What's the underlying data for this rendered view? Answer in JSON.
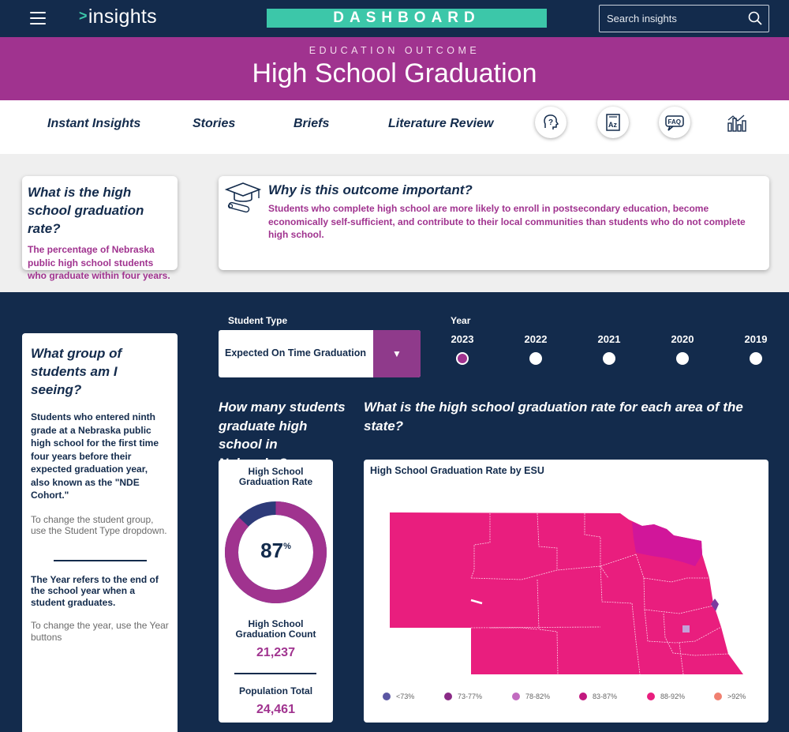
{
  "topbar": {
    "logo_chevron": ">",
    "logo_text": "insights",
    "banner": "DASHBOARD",
    "search_placeholder": "Search insights"
  },
  "hero": {
    "kicker": "EDUCATION OUTCOME",
    "title": "High School Graduation"
  },
  "nav": {
    "links": [
      "Instant Insights",
      "Stories",
      "Briefs",
      "Literature Review"
    ],
    "icon_buttons": [
      "question-head-icon",
      "glossary-az-icon",
      "faq-icon",
      "bar-chart-icon"
    ]
  },
  "info": {
    "definition": {
      "title": "What is the high school graduation rate?",
      "body": "The percentage of Nebraska public high school students who graduate within four years."
    },
    "importance": {
      "title": "Why is this outcome important?",
      "body": "Students who complete high school are more likely to enroll in postsecondary education, become economically self-sufficient, and contribute to their local communities than students who do not complete high school."
    }
  },
  "sidebar": {
    "title": "What group of students am I seeing?",
    "desc": "Students who entered ninth grade at a Nebraska public high school for the first time four years before their expected graduation year, also known as the \"NDE Cohort.\"",
    "hint1": "To change the student group, use the Student Type dropdown.",
    "desc2": "The Year refers to the end of the school year when a student graduates.",
    "hint2": "To change the year, use the Year buttons"
  },
  "filters": {
    "student_type_label": "Student Type",
    "student_type_value": "Expected On Time Graduation",
    "year_label": "Year",
    "years": [
      "2023",
      "2022",
      "2021",
      "2020",
      "2019"
    ],
    "selected_year": "2023"
  },
  "questions": {
    "count_q": "How many students graduate high school in Nebraska?",
    "map_q": "What is the high school graduation rate for each area of the state?"
  },
  "kpi": {
    "rate_title": "High School Graduation Rate",
    "rate_value": "87",
    "rate_unit": "%",
    "rate_fraction": 0.87,
    "count_title": "High School Graduation Count",
    "count_value": "21,237",
    "pop_title": "Population Total",
    "pop_value": "24,461",
    "colors": {
      "fill": "#a0338f",
      "rest": "#2d3a78"
    }
  },
  "map": {
    "title": "High School Graduation Rate by ESU",
    "legend": [
      {
        "label": "<73%",
        "color": "#5b57a3"
      },
      {
        "label": "73-77%",
        "color": "#8a2a86"
      },
      {
        "label": "78-82%",
        "color": "#c26bc0"
      },
      {
        "label": "83-87%",
        "color": "#c2187f"
      },
      {
        "label": "88-92%",
        "color": "#e91e7e"
      },
      {
        "label": ">92%",
        "color": "#f08070"
      }
    ]
  }
}
